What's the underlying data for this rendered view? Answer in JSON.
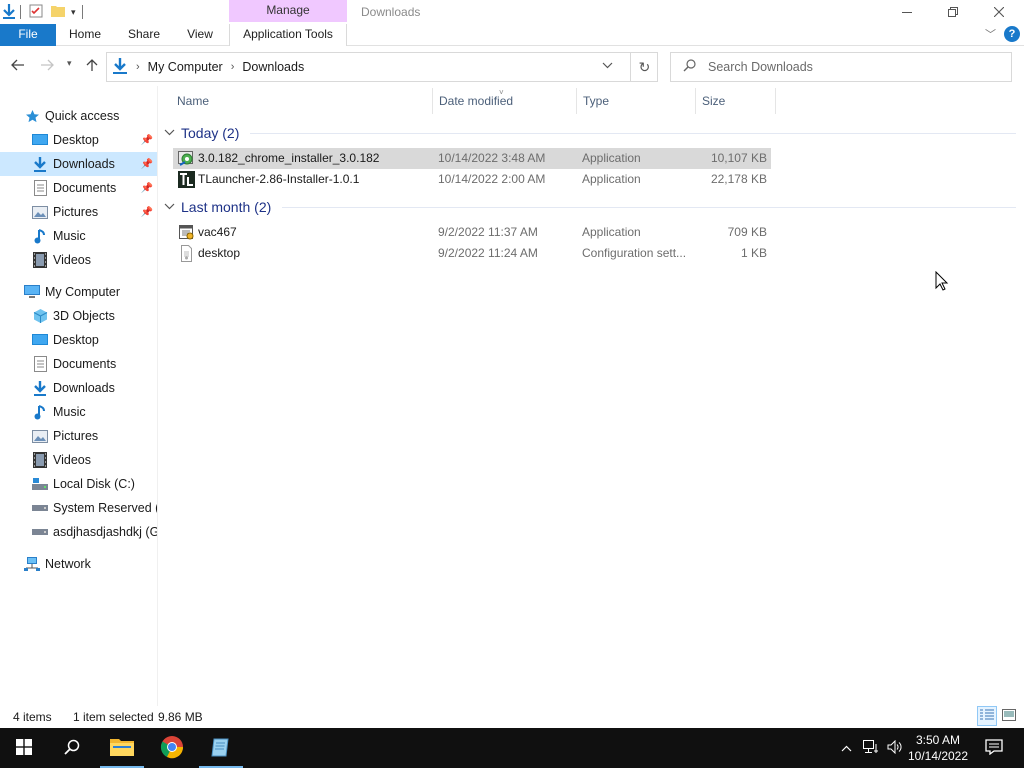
{
  "window": {
    "title": "Downloads",
    "manage_tab": "Manage"
  },
  "ribbon": {
    "tabs": [
      "File",
      "Home",
      "Share",
      "View",
      "Application Tools"
    ]
  },
  "address": {
    "crumbs": [
      "My Computer",
      "Downloads"
    ]
  },
  "search": {
    "placeholder": "Search Downloads"
  },
  "nav": {
    "quick_access": {
      "label": "Quick access",
      "items": [
        "Desktop",
        "Downloads",
        "Documents",
        "Pictures",
        "Music",
        "Videos"
      ]
    },
    "my_computer": {
      "label": "My Computer",
      "items": [
        "3D Objects",
        "Desktop",
        "Documents",
        "Downloads",
        "Music",
        "Pictures",
        "Videos",
        "Local Disk (C:)",
        "System Reserved (E:",
        "asdjhasdjashdkj (G:)"
      ]
    },
    "network": "Network",
    "selected": "Downloads"
  },
  "columns": [
    "Name",
    "Date modified",
    "Type",
    "Size"
  ],
  "groups": [
    {
      "label": "Today (2)",
      "files": [
        {
          "name": "3.0.182_chrome_installer_3.0.182",
          "date": "10/14/2022 3:48 AM",
          "type": "Application",
          "size": "10,107 KB",
          "icon": "installer-icon",
          "selected": true
        },
        {
          "name": "TLauncher-2.86-Installer-1.0.1",
          "date": "10/14/2022 2:00 AM",
          "type": "Application",
          "size": "22,178 KB",
          "icon": "tlauncher-icon",
          "selected": false
        }
      ]
    },
    {
      "label": "Last month (2)",
      "files": [
        {
          "name": "vac467",
          "date": "9/2/2022 11:37 AM",
          "type": "Application",
          "size": "709 KB",
          "icon": "app-icon",
          "selected": false
        },
        {
          "name": "desktop",
          "date": "9/2/2022 11:24 AM",
          "type": "Configuration sett...",
          "size": "1 KB",
          "icon": "config-file-icon",
          "selected": false
        }
      ]
    }
  ],
  "status": {
    "items": "4 items",
    "selection": "1 item selected",
    "selection_size": "9.86 MB"
  },
  "taskbar": {
    "time": "3:50 AM",
    "date": "10/14/2022"
  },
  "colors": {
    "accent": "#1979ca",
    "manage_tab": "#f0c8ff",
    "selection": "#cce8ff",
    "row_selected": "#d9d9d9",
    "group_header": "#1e3287",
    "taskbar": "#101010"
  }
}
